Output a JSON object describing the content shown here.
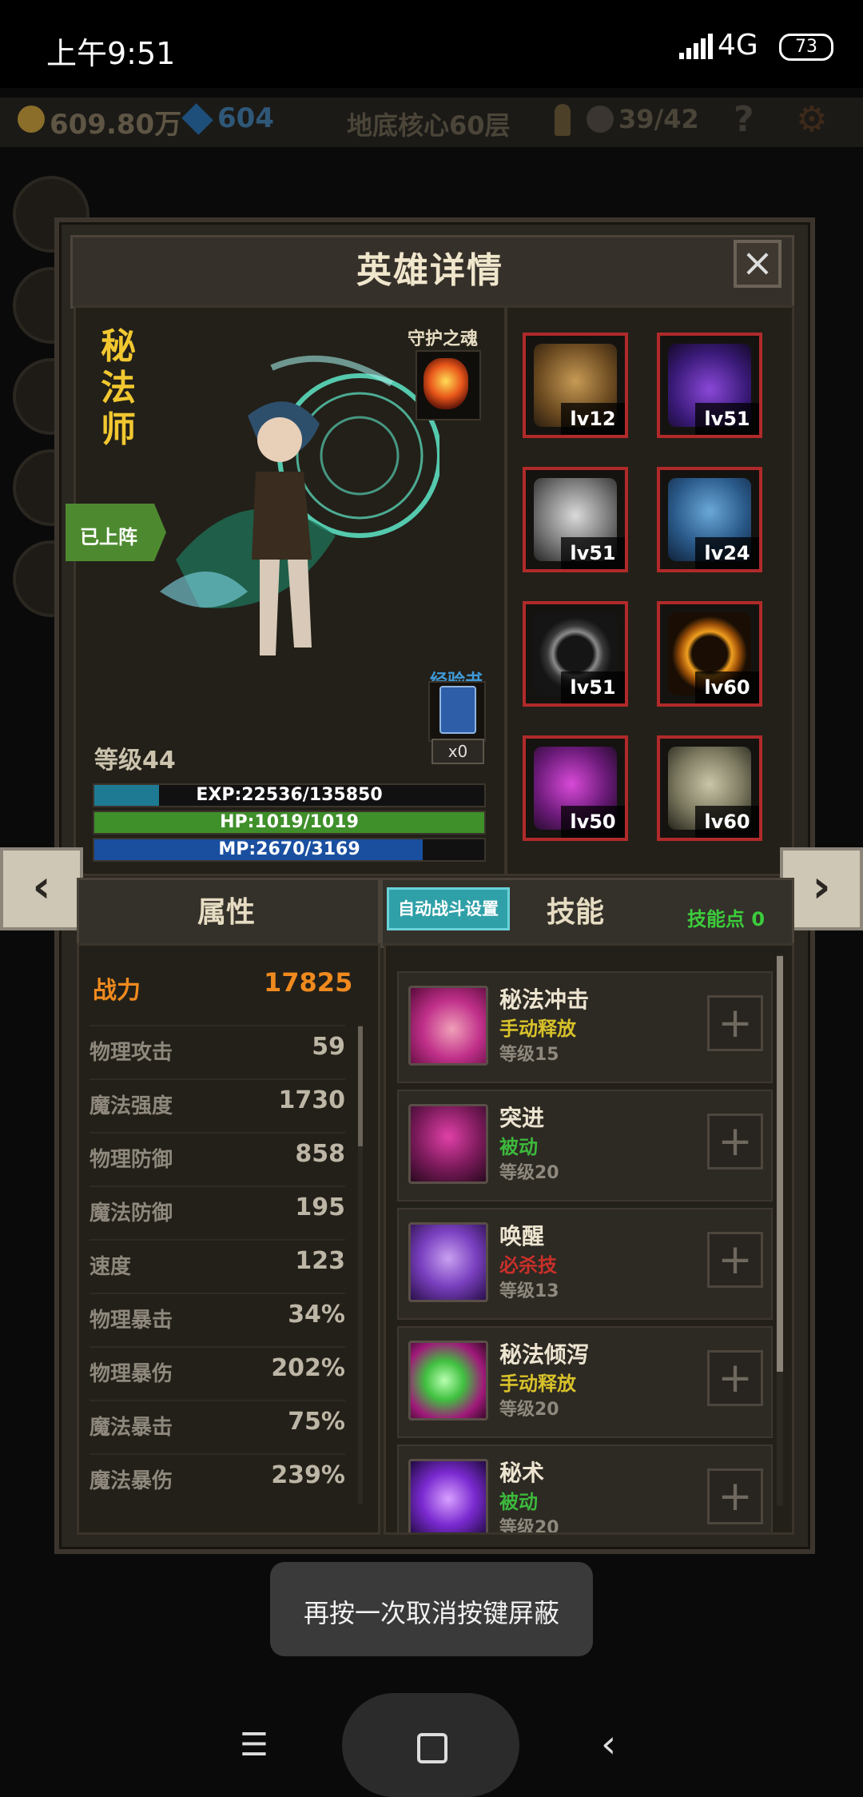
{
  "status_bar": {
    "time": "上午9:51",
    "network": "4G",
    "battery": "73"
  },
  "resources": {
    "gold": "609.80万",
    "gems": "604",
    "floor": "地底核心60层",
    "kills": "39/42",
    "help": "?"
  },
  "panel": {
    "title": "英雄详情",
    "close": "×"
  },
  "hero": {
    "class_name": "秘法师",
    "deployed_label": "已上阵",
    "guard_label": "守护之魂",
    "exp_book_label": "经验书",
    "exp_book_count": "x0",
    "level": "等级44",
    "exp": {
      "text": "EXP:22536/135850",
      "fraction": 0.166
    },
    "hp": {
      "text": "HP:1019/1019",
      "fraction": 1.0
    },
    "mp": {
      "text": "MP:2670/3169",
      "fraction": 0.843
    }
  },
  "equipment": [
    {
      "level": "lv12",
      "rarity": "red",
      "item_icon": "helmet-icon"
    },
    {
      "level": "lv51",
      "rarity": "orange",
      "item_icon": "amulet-icon"
    },
    {
      "level": "lv51",
      "rarity": "orange",
      "item_icon": "chest-armor-icon"
    },
    {
      "level": "lv24",
      "rarity": "red",
      "item_icon": "boots-icon"
    },
    {
      "level": "lv51",
      "rarity": "orange",
      "item_icon": "bracelet-icon"
    },
    {
      "level": "lv60",
      "rarity": "red",
      "item_icon": "ring-icon"
    },
    {
      "level": "lv50",
      "rarity": "red",
      "item_icon": "glove-icon"
    },
    {
      "level": "lv60",
      "rarity": "orange",
      "item_icon": "pauldron-icon"
    }
  ],
  "nav": {
    "prev": "‹",
    "next": "›"
  },
  "attributes": {
    "tab_label": "属性",
    "power_label": "战力",
    "power_value": "17825",
    "rows": [
      {
        "label": "物理攻击",
        "value": "59"
      },
      {
        "label": "魔法强度",
        "value": "1730"
      },
      {
        "label": "物理防御",
        "value": "858"
      },
      {
        "label": "魔法防御",
        "value": "195"
      },
      {
        "label": "速度",
        "value": "123"
      },
      {
        "label": "物理暴击",
        "value": "34%"
      },
      {
        "label": "物理暴伤",
        "value": "202%"
      },
      {
        "label": "魔法暴击",
        "value": "75%"
      },
      {
        "label": "魔法暴伤",
        "value": "239%"
      }
    ]
  },
  "skills": {
    "auto_battle_label": "自动战斗设置",
    "tab_label": "技能",
    "points_label": "技能点 0",
    "list": [
      {
        "name": "秘法冲击",
        "type": "手动释放",
        "type_color": "#d8c22a",
        "level": "等级15"
      },
      {
        "name": "突进",
        "type": "被动",
        "type_color": "#3cb83c",
        "level": "等级20"
      },
      {
        "name": "唤醒",
        "type": "必杀技",
        "type_color": "#c8302a",
        "level": "等级13"
      },
      {
        "name": "秘法倾泻",
        "type": "手动释放",
        "type_color": "#d8c22a",
        "level": "等级20"
      },
      {
        "name": "秘术",
        "type": "被动",
        "type_color": "#3cb83c",
        "level": "等级20"
      }
    ],
    "add_label": "+"
  },
  "toast": "再按一次取消按键屏蔽",
  "navbar": {
    "menu": "☰",
    "back": "‹"
  }
}
